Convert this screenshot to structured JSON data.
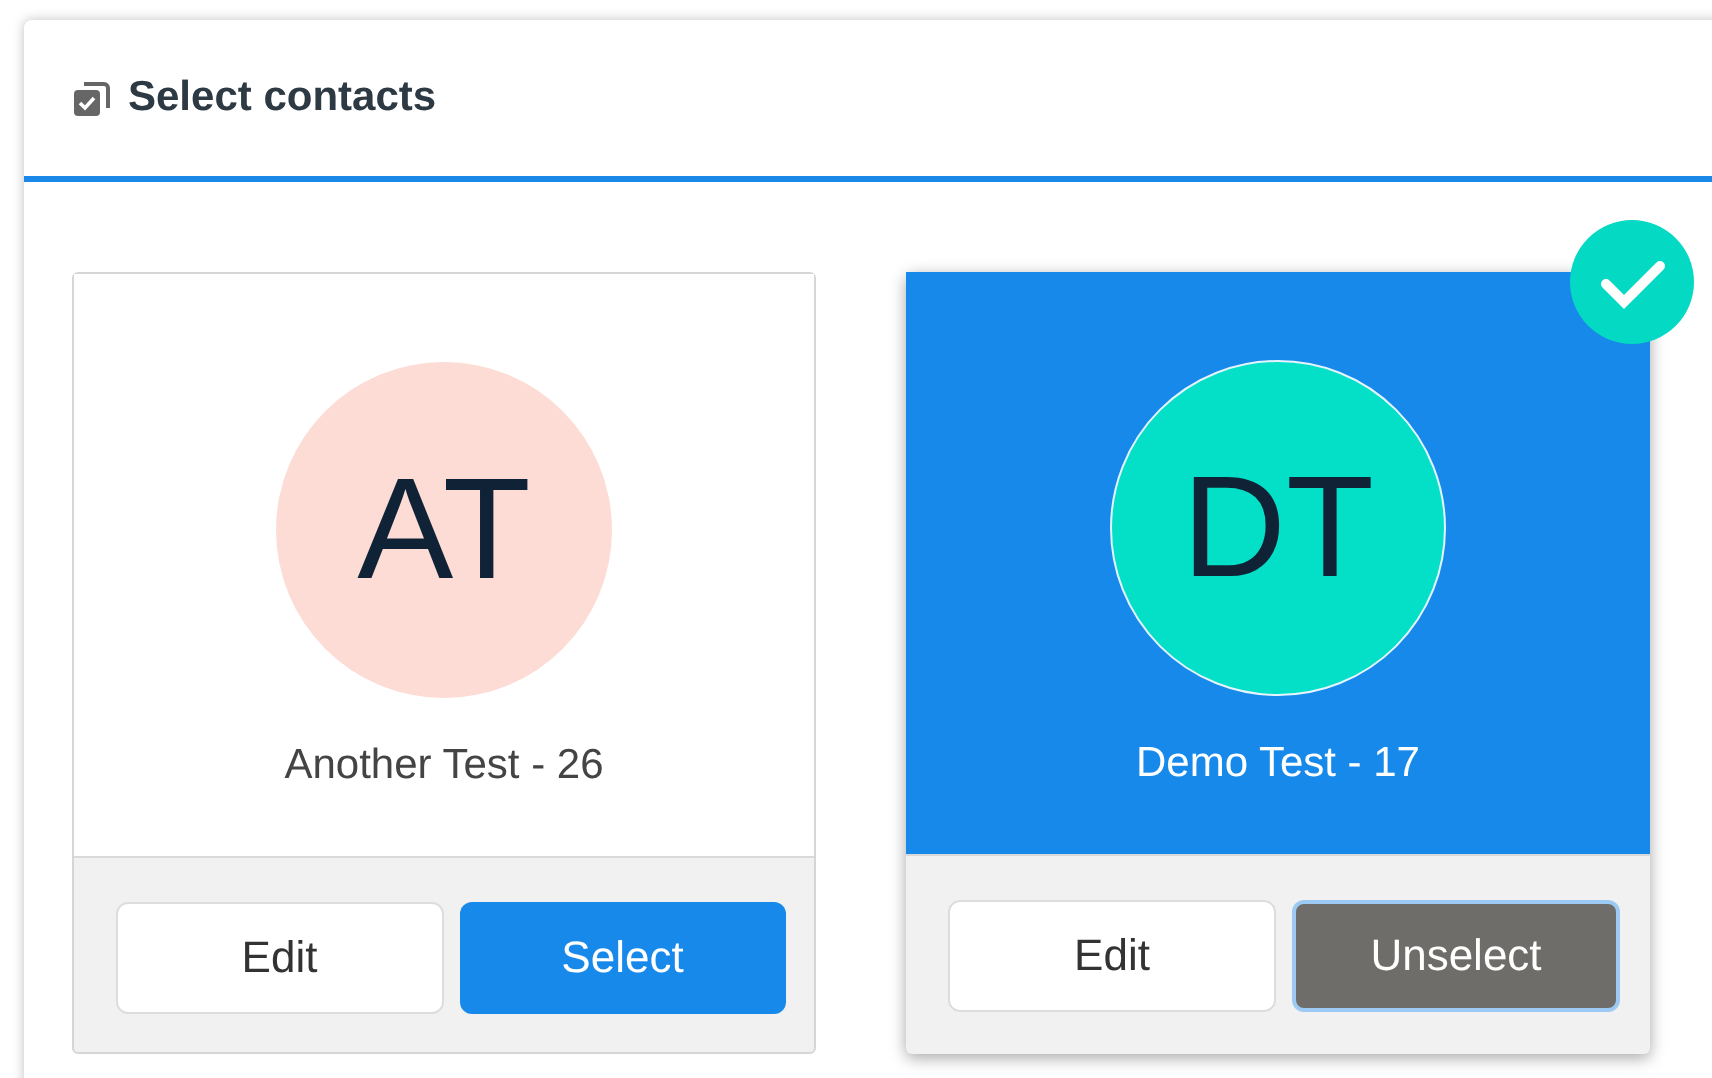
{
  "panel": {
    "title": "Select contacts"
  },
  "contacts": [
    {
      "initials": "AT",
      "name": "Another Test - 26",
      "color": "#fcdcd4",
      "selected": false,
      "edit_label": "Edit",
      "toggle_label": "Select"
    },
    {
      "initials": "DT",
      "name": "Demo Test - 17",
      "color": "#04e0c8",
      "selected": true,
      "edit_label": "Edit",
      "toggle_label": "Unselect"
    }
  ]
}
